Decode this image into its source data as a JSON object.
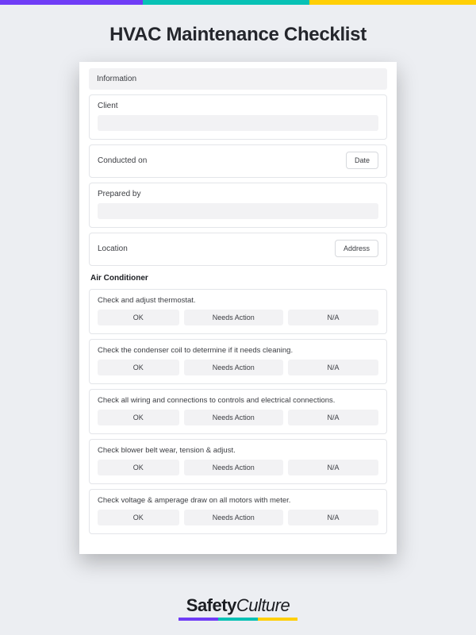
{
  "title": "HVAC Maintenance Checklist",
  "section1": {
    "header": "Information"
  },
  "fields": {
    "client": {
      "label": "Client"
    },
    "conducted": {
      "label": "Conducted on",
      "button": "Date"
    },
    "prepared": {
      "label": "Prepared by"
    },
    "location": {
      "label": "Location",
      "button": "Address"
    }
  },
  "subsection": "Air Conditioner",
  "options": {
    "ok": "OK",
    "needs": "Needs Action",
    "na": "N/A"
  },
  "questions": [
    "Check and adjust thermostat.",
    "Check the condenser coil to determine if it needs cleaning.",
    "Check all wiring and connections to controls and electrical connections.",
    "Check blower belt wear, tension & adjust.",
    "Check voltage & amperage draw on all motors with meter."
  ],
  "logo": {
    "part1": "Safety",
    "part2": "Culture"
  }
}
